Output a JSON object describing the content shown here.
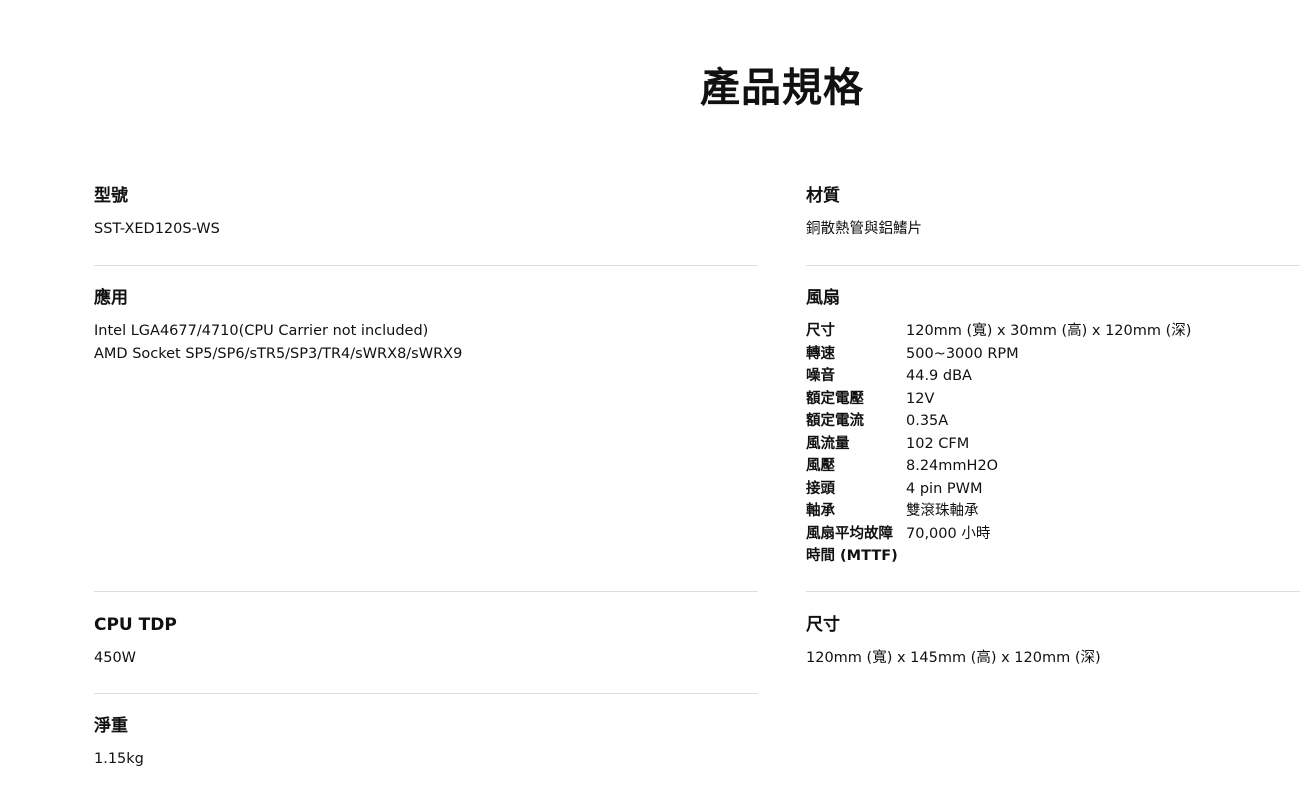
{
  "page_title": "產品規格",
  "left": {
    "model": {
      "heading": "型號",
      "value": "SST-XED120S-WS"
    },
    "application": {
      "heading": "應用",
      "lines": [
        "Intel LGA4677/4710(CPU Carrier not included)",
        "AMD Socket SP5/SP6/sTR5/SP3/TR4/sWRX8/sWRX9"
      ]
    },
    "cpu_tdp": {
      "heading": "CPU TDP",
      "value": "450W"
    },
    "net_weight": {
      "heading": "淨重",
      "value": "1.15kg"
    }
  },
  "right": {
    "material": {
      "heading": "材質",
      "value": "銅散熱管與鋁鰭片"
    },
    "fan": {
      "heading": "風扇",
      "rows": [
        {
          "key": "尺寸",
          "value": "120mm (寬) x 30mm (高) x 120mm (深)"
        },
        {
          "key": "轉速",
          "value": "500~3000 RPM"
        },
        {
          "key": "噪音",
          "value": "44.9 dBA"
        },
        {
          "key": "額定電壓",
          "value": "12V"
        },
        {
          "key": "額定電流",
          "value": "0.35A"
        },
        {
          "key": "風流量",
          "value": "102 CFM"
        },
        {
          "key": "風壓",
          "value": "8.24mmH2O"
        },
        {
          "key": "接頭",
          "value": "4 pin PWM"
        },
        {
          "key": "軸承",
          "value": "雙滾珠軸承"
        },
        {
          "key": "風扇平均故障",
          "value": "70,000 小時"
        },
        {
          "key": "時間 (MTTF)",
          "value": ""
        }
      ]
    },
    "dimensions": {
      "heading": "尺寸",
      "value": "120mm (寬) x 145mm (高) x 120mm (深)"
    }
  }
}
